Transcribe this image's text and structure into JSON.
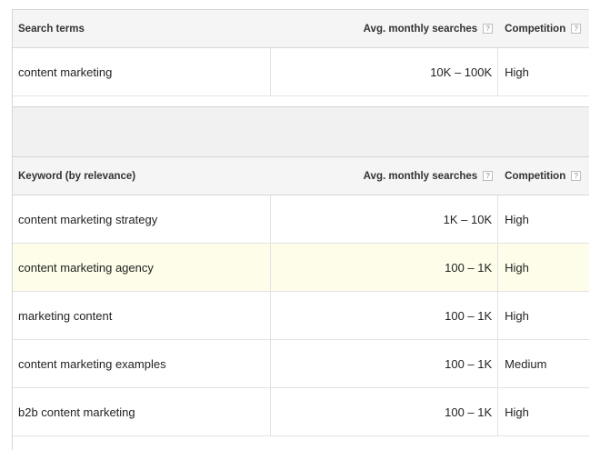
{
  "search_terms_table": {
    "headers": {
      "keyword": "Search terms",
      "avg_monthly_searches": "Avg. monthly searches",
      "competition": "Competition"
    },
    "help_icon_glyph": "?",
    "rows": [
      {
        "keyword": "content marketing",
        "avg_monthly_searches": "10K – 100K",
        "competition": "High"
      }
    ]
  },
  "keyword_ideas_table": {
    "headers": {
      "keyword": "Keyword (by relevance)",
      "avg_monthly_searches": "Avg. monthly searches",
      "competition": "Competition"
    },
    "help_icon_glyph": "?",
    "rows": [
      {
        "keyword": "content marketing strategy",
        "avg_monthly_searches": "1K – 10K",
        "competition": "High"
      },
      {
        "keyword": "content marketing agency",
        "avg_monthly_searches": "100 – 1K",
        "competition": "High"
      },
      {
        "keyword": "marketing content",
        "avg_monthly_searches": "100 – 1K",
        "competition": "High"
      },
      {
        "keyword": "content marketing examples",
        "avg_monthly_searches": "100 – 1K",
        "competition": "Medium"
      },
      {
        "keyword": "b2b content marketing",
        "avg_monthly_searches": "100 – 1K",
        "competition": "High"
      }
    ]
  },
  "colors": {
    "header_background": "#f5f5f5",
    "highlight_row": "#fdfde9",
    "separator_band": "#f1f1f1"
  }
}
